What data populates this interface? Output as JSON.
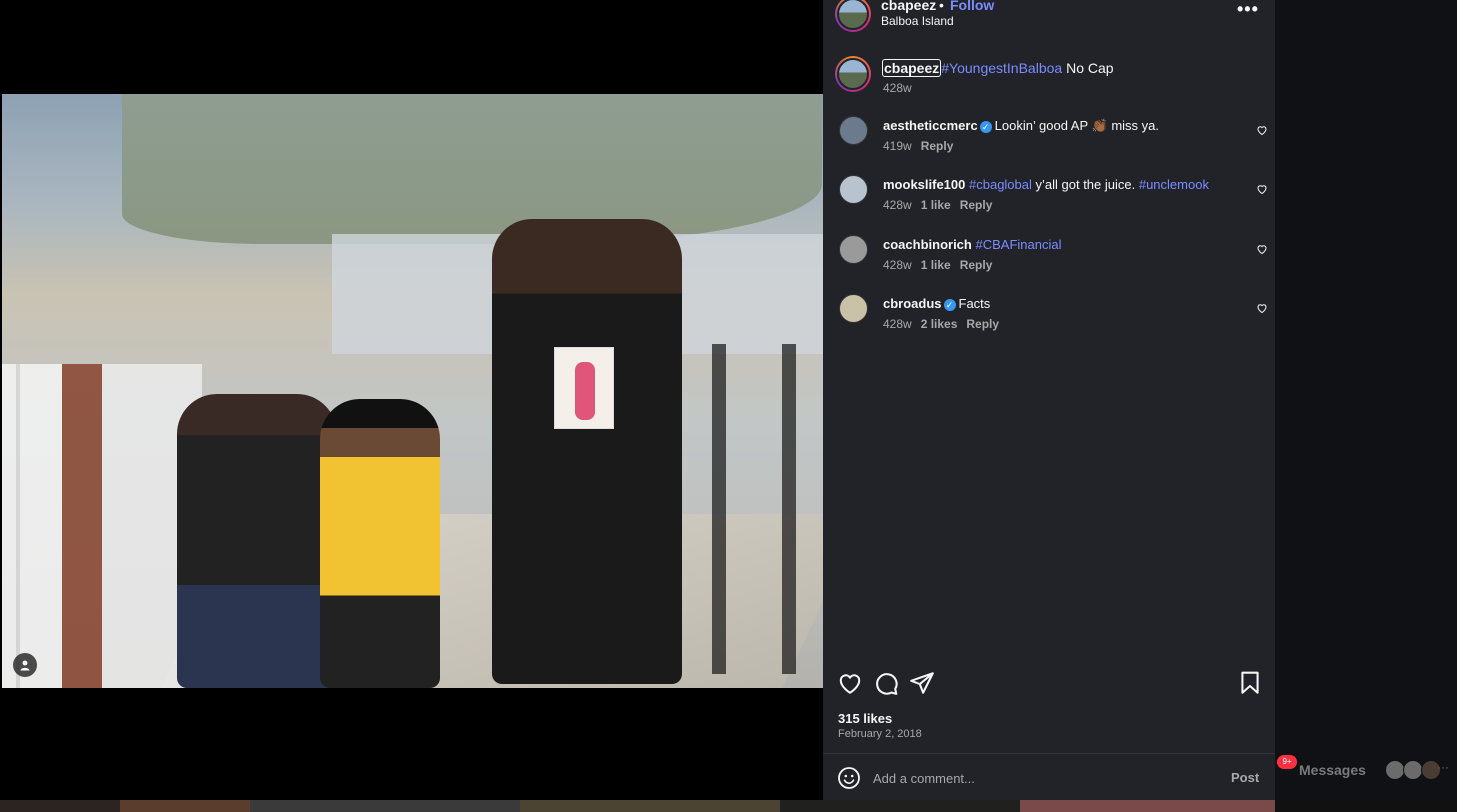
{
  "post": {
    "username": "cbapeez",
    "separator": "•",
    "follow_label": "Follow",
    "location": "Balboa Island",
    "more_label": "•••"
  },
  "caption": {
    "username": "cbapeez",
    "hashtag": "#YoungestInBalboa",
    "text": " No Cap",
    "time": "428w"
  },
  "comments": [
    {
      "username": "aestheticcmerc",
      "verified": true,
      "text_before": "Lookin’ good AP ",
      "emoji": "👏🏾",
      "text_after": " miss ya.",
      "time": "419w",
      "likes": "",
      "reply": "Reply",
      "avatar_color": "#6b7a8c"
    },
    {
      "username": "mookslife100",
      "verified": false,
      "hashtag1": "#cbaglobal",
      "text_mid": " y’all got the juice. ",
      "hashtag2": "#unclemook",
      "time": "428w",
      "likes": "1 like",
      "reply": "Reply",
      "avatar_color": "#b9c3cf"
    },
    {
      "username": "coachbinorich",
      "verified": false,
      "hashtag1": "#CBAFinancial",
      "time": "428w",
      "likes": "1 like",
      "reply": "Reply",
      "avatar_color": "#9a9a9a"
    },
    {
      "username": "cbroadus",
      "verified": true,
      "text": "Facts",
      "time": "428w",
      "likes": "2 likes",
      "reply": "Reply",
      "avatar_color": "#c9c2a8"
    }
  ],
  "actions": {
    "likes": "315 likes",
    "date": "February 2, 2018"
  },
  "add_comment": {
    "placeholder": "Add a comment...",
    "post_label": "Post"
  },
  "messages": {
    "badge": "9+",
    "label": "Messages"
  },
  "colors": {
    "panel_bg": "#212328",
    "link_blue": "#7b8cff",
    "verified_blue": "#3897f0"
  }
}
